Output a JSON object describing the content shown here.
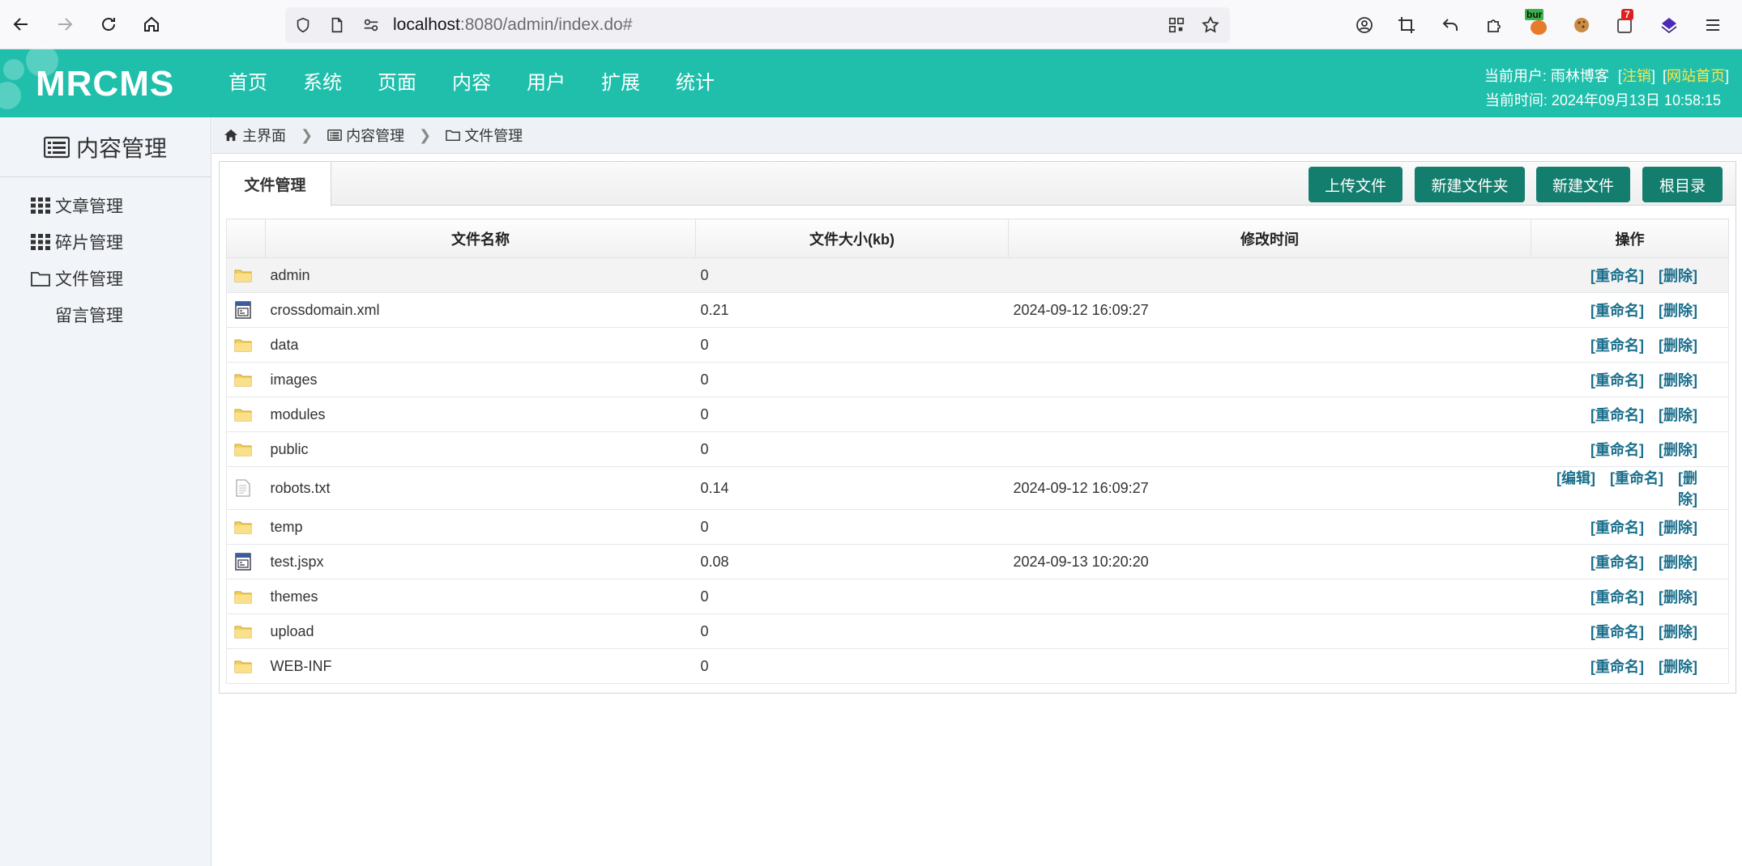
{
  "browser": {
    "url_host": "localhost",
    "url_rest": ":8080/admin/index.do#",
    "extension_badge_label": "bur",
    "notification_count": "7"
  },
  "app": {
    "logo": "MRCMS",
    "nav": [
      "首页",
      "系统",
      "页面",
      "内容",
      "用户",
      "扩展",
      "统计"
    ],
    "user_label": "当前用户: 雨林博客",
    "logout_label": "注销",
    "home_link_label": "网站首页",
    "time_label": "当前时间: 2024年09月13日 10:58:15",
    "accent_color": "#1fbfac",
    "button_color": "#147e6e"
  },
  "sidebar": {
    "title": "内容管理",
    "items": [
      {
        "label": "文章管理",
        "icon": "grid-icon"
      },
      {
        "label": "碎片管理",
        "icon": "grid-icon"
      },
      {
        "label": "文件管理",
        "icon": "folder-outline-icon"
      },
      {
        "label": "留言管理",
        "icon": ""
      }
    ]
  },
  "breadcrumb": [
    "主界面",
    "内容管理",
    "文件管理"
  ],
  "panel": {
    "tab": "文件管理",
    "buttons": [
      "上传文件",
      "新建文件夹",
      "新建文件",
      "根目录"
    ]
  },
  "table": {
    "headers": [
      "文件名称",
      "文件大小(kb)",
      "修改时间",
      "操作"
    ],
    "edit_label": "[编辑]",
    "rename_label": "[重命名]",
    "delete_label": "[删除]",
    "rows": [
      {
        "name": "admin",
        "size": "0",
        "time": "",
        "type": "folder"
      },
      {
        "name": "crossdomain.xml",
        "size": "0.21",
        "time": "2024-09-12 16:09:27",
        "type": "xml"
      },
      {
        "name": "data",
        "size": "0",
        "time": "",
        "type": "folder"
      },
      {
        "name": "images",
        "size": "0",
        "time": "",
        "type": "folder"
      },
      {
        "name": "modules",
        "size": "0",
        "time": "",
        "type": "folder"
      },
      {
        "name": "public",
        "size": "0",
        "time": "",
        "type": "folder"
      },
      {
        "name": "robots.txt",
        "size": "0.14",
        "time": "2024-09-12 16:09:27",
        "type": "text"
      },
      {
        "name": "temp",
        "size": "0",
        "time": "",
        "type": "folder"
      },
      {
        "name": "test.jspx",
        "size": "0.08",
        "time": "2024-09-13 10:20:20",
        "type": "xml"
      },
      {
        "name": "themes",
        "size": "0",
        "time": "",
        "type": "folder"
      },
      {
        "name": "upload",
        "size": "0",
        "time": "",
        "type": "folder"
      },
      {
        "name": "WEB-INF",
        "size": "0",
        "time": "",
        "type": "folder"
      }
    ]
  }
}
